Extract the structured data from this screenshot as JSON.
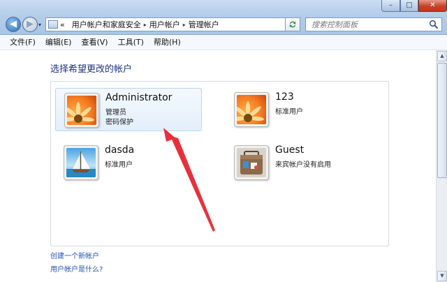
{
  "window": {
    "minimize_glyph": "–",
    "maximize_glyph": "□",
    "close_glyph": "✕"
  },
  "nav": {
    "back_glyph": "◀",
    "forward_glyph": "▶",
    "dropdown_glyph": "▾"
  },
  "address": {
    "prefix": "«",
    "crumbs": [
      "用户帐户和家庭安全",
      "用户帐户",
      "管理帐户"
    ],
    "separator": "▸"
  },
  "search": {
    "placeholder": "搜索控制面板"
  },
  "menu": [
    "文件(F)",
    "编辑(E)",
    "查看(V)",
    "工具(T)",
    "帮助(H)"
  ],
  "heading": "选择希望更改的帐户",
  "accounts": [
    {
      "name": "Administrator",
      "role": "管理员",
      "extra": "密码保护",
      "icon": "flower-avatar-icon",
      "selected": true
    },
    {
      "name": "123",
      "role": "标准用户",
      "extra": "",
      "icon": "flower-avatar-icon",
      "selected": false
    },
    {
      "name": "dasda",
      "role": "标准用户",
      "extra": "",
      "icon": "sailboat-avatar-icon",
      "selected": false
    },
    {
      "name": "Guest",
      "role": "来宾帐户没有启用",
      "extra": "",
      "icon": "guest-suitcase-icon",
      "selected": false
    }
  ],
  "links": [
    "创建一个新帐户",
    "用户帐户是什么?"
  ],
  "annotation": {
    "color": "#e8303a"
  },
  "colors": {
    "heading": "#1e3287",
    "link": "#2351b5",
    "selection_border": "#b8d6f2"
  }
}
